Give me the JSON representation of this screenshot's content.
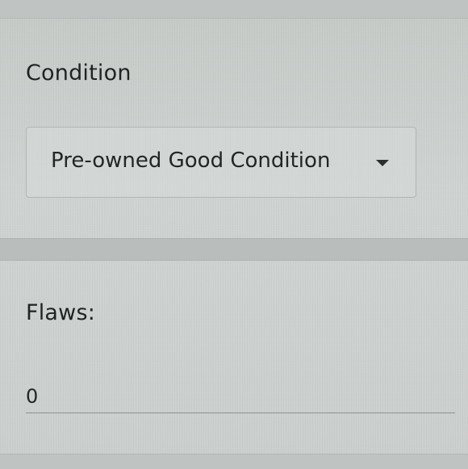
{
  "condition": {
    "label": "Condition",
    "selected_value": "Pre-owned Good Condition"
  },
  "flaws": {
    "label": "Flaws:",
    "value": "0"
  }
}
